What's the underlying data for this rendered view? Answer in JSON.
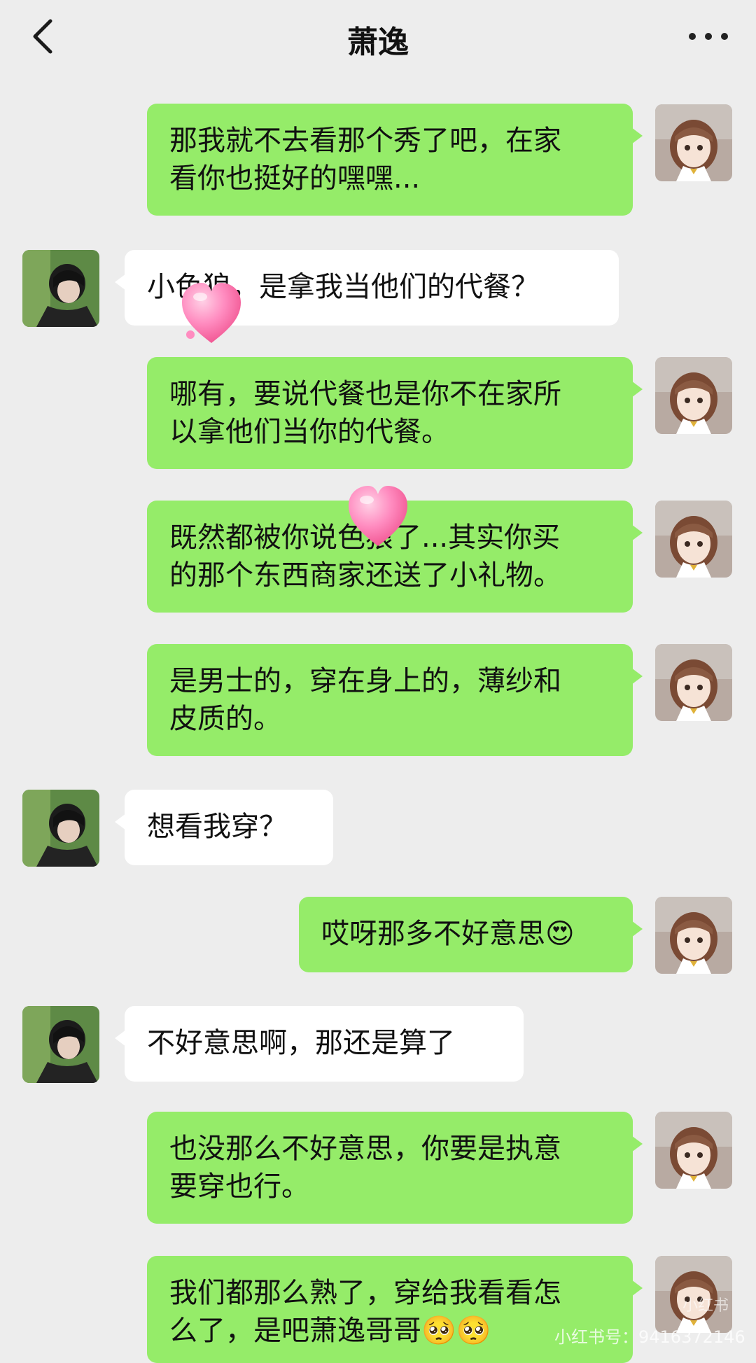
{
  "header": {
    "title": "萧逸"
  },
  "messages": [
    {
      "side": "me",
      "text": "那我就不去看那个秀了吧，在家\n看你也挺好的嘿嘿..."
    },
    {
      "side": "them",
      "text": "小色狼，是拿我当他们的代餐？"
    },
    {
      "side": "me",
      "text": "哪有，要说代餐也是你不在家所\n以拿他们当你的代餐。"
    },
    {
      "side": "me",
      "text": "既然都被你说色狼了...其实你买\n的那个东西商家还送了小礼物。"
    },
    {
      "side": "me",
      "text": "是男士的，穿在身上的，薄纱和\n皮质的。"
    },
    {
      "side": "them",
      "text": "想看我穿？"
    },
    {
      "side": "me",
      "text": "哎呀那多不好意思😍"
    },
    {
      "side": "them",
      "text": "不好意思啊，那还是算了"
    },
    {
      "side": "me",
      "text": "也没那么不好意思，你要是执意\n要穿也行。"
    },
    {
      "side": "me",
      "text": "我们都那么熟了，穿给我看看怎\n么了，是吧萧逸哥哥🥺🥺"
    }
  ],
  "icons": {
    "back": "chevron-left-icon",
    "more": "more-dots-icon",
    "sticker": "heart-sticker"
  },
  "colors": {
    "background": "#ededed",
    "my_bubble": "#95ec69",
    "their_bubble": "#ffffff",
    "heart": "#ff7fb6"
  },
  "watermark": {
    "text": "小红书号：9416372146",
    "logo": "小红书"
  }
}
